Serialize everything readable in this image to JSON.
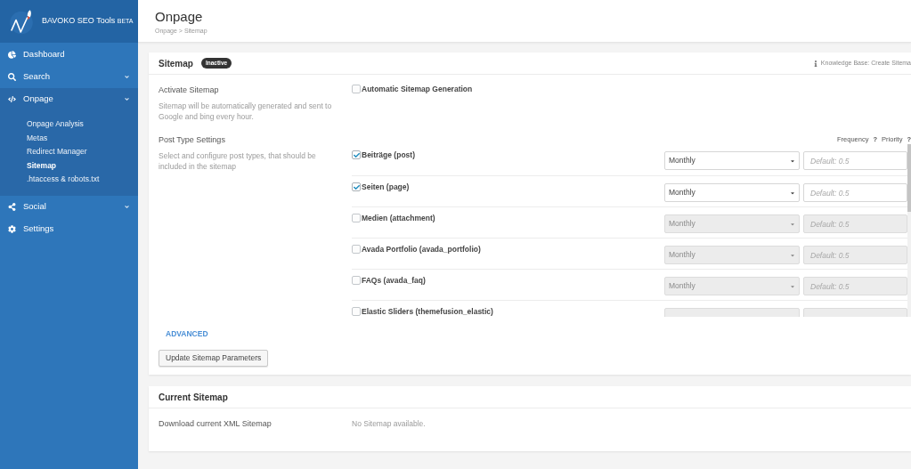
{
  "sidebar": {
    "brand": {
      "name": "BAVOKO SEO Tools",
      "tag": "BETA"
    },
    "items": [
      {
        "label": "Dashboard",
        "kind": "link"
      },
      {
        "label": "Search",
        "kind": "group",
        "expanded": false
      },
      {
        "label": "Onpage",
        "kind": "group",
        "expanded": true,
        "children": [
          {
            "label": "Onpage Analysis",
            "selected": false
          },
          {
            "label": "Metas",
            "selected": false
          },
          {
            "label": "Redirect Manager",
            "selected": false
          },
          {
            "label": "Sitemap",
            "selected": true
          },
          {
            "label": ".htaccess & robots.txt",
            "selected": false
          }
        ]
      },
      {
        "label": "Social",
        "kind": "group",
        "expanded": false
      },
      {
        "label": "Settings",
        "kind": "link"
      }
    ]
  },
  "header": {
    "title": "Onpage",
    "breadcrumb": "Onpage > Sitemap"
  },
  "sitemap_card": {
    "title": "Sitemap",
    "status": "Inactive",
    "help_link": "Knowledge Base: Create Sitema",
    "activate": {
      "label": "Activate Sitemap",
      "description": "Sitemap will be automatically generated and sent to Google and bing every hour.",
      "option": {
        "label": "Automatic Sitemap Generation",
        "checked": false
      }
    },
    "post_types": {
      "label": "Post Type Settings",
      "description": "Select and configure post types, that should be included in the sitemap",
      "columns": [
        {
          "label": "Frequency",
          "help": "?"
        },
        {
          "label": "Priority",
          "help": "?"
        }
      ],
      "rows": [
        {
          "label": "Beiträge (post)",
          "checked": true,
          "frequency": "Monthly",
          "placeholder": "Default: 0.5"
        },
        {
          "label": "Seiten (page)",
          "checked": true,
          "frequency": "Monthly",
          "placeholder": "Default: 0.5"
        },
        {
          "label": "Medien (attachment)",
          "checked": false,
          "frequency": "Monthly",
          "placeholder": "Default: 0.5"
        },
        {
          "label": "Avada Portfolio (avada_portfolio)",
          "checked": false,
          "frequency": "Monthly",
          "placeholder": "Default: 0.5"
        },
        {
          "label": "FAQs (avada_faq)",
          "checked": false,
          "frequency": "Monthly",
          "placeholder": "Default: 0.5"
        },
        {
          "label": "Elastic Sliders (themefusion_elastic)",
          "checked": false
        }
      ]
    },
    "advanced_link": "ADVANCED",
    "submit_button": "Update Sitemap Parameters"
  },
  "current_sitemap_card": {
    "title": "Current Sitemap",
    "rows": [
      {
        "label": "Download current XML Sitemap",
        "value": "No Sitemap available."
      }
    ]
  }
}
